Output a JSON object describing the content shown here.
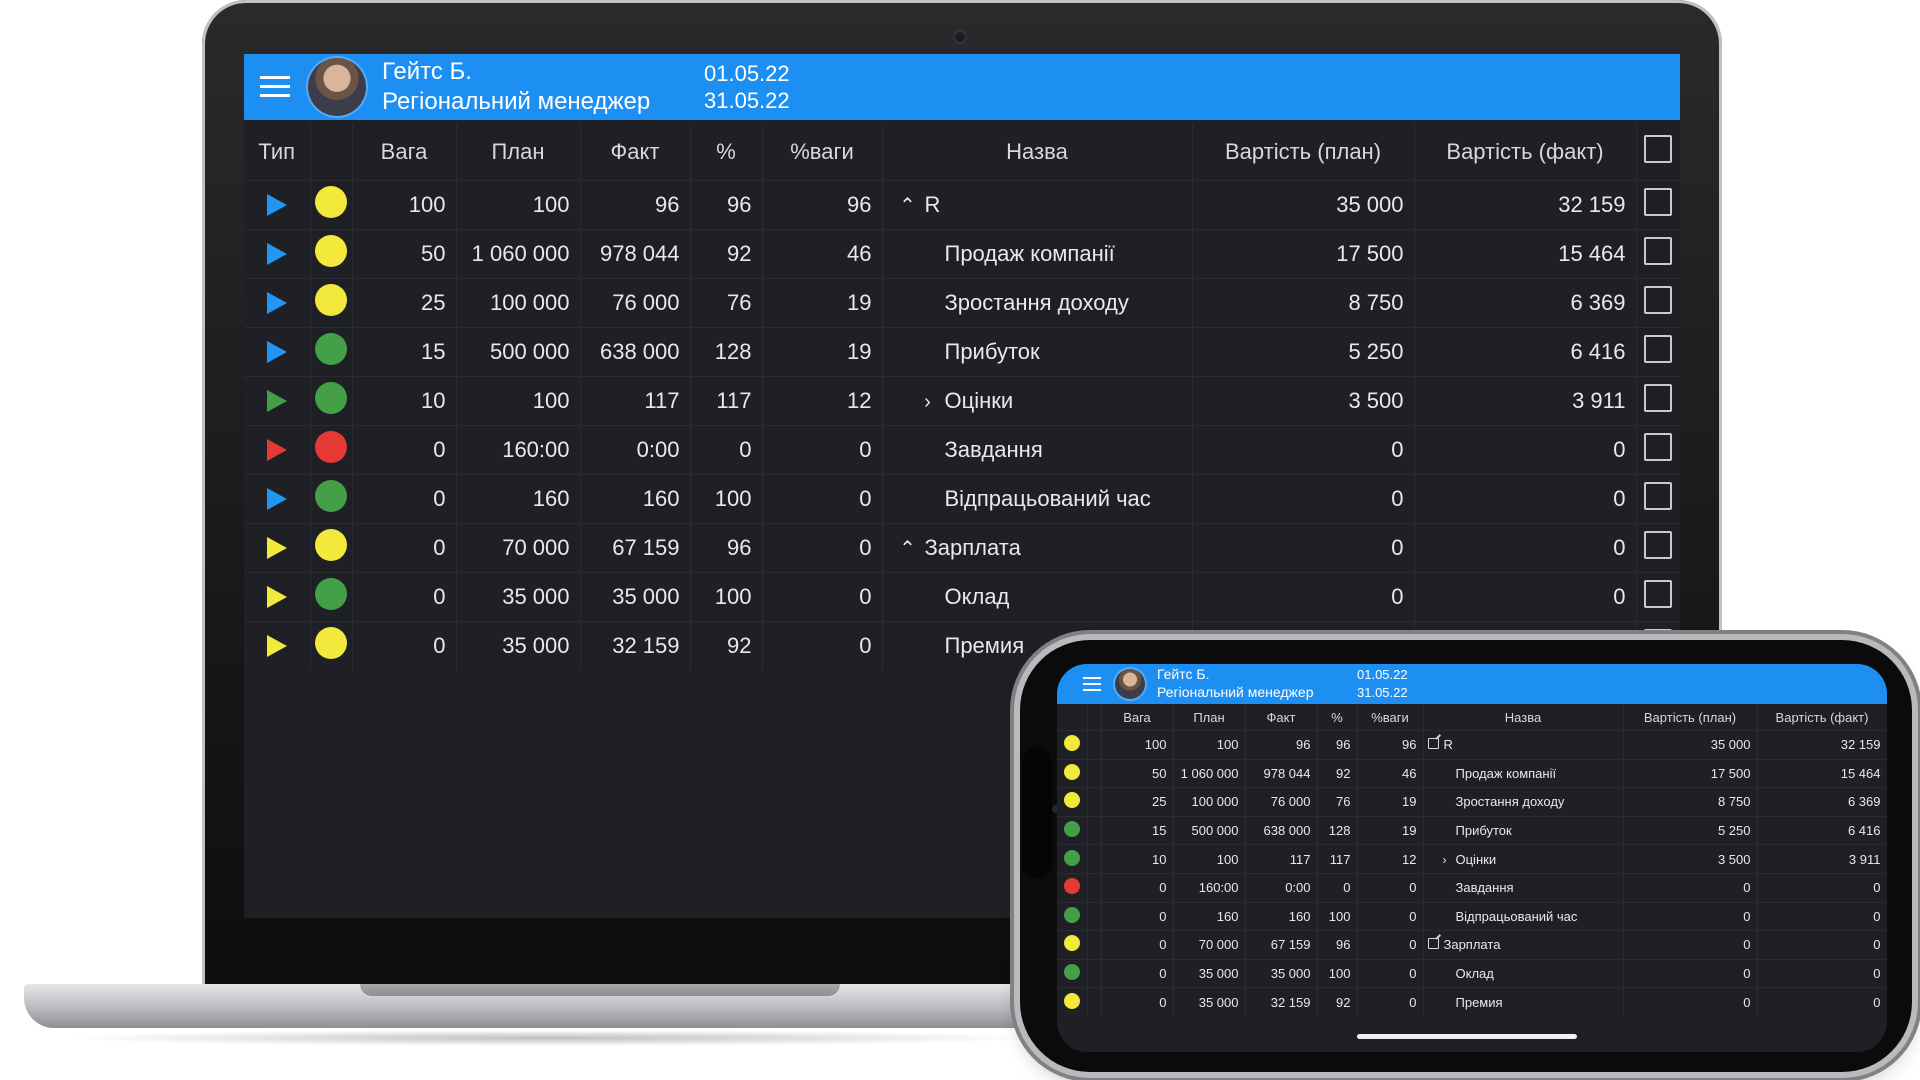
{
  "header": {
    "user_name": "Гейтс Б.",
    "user_role": "Регіональний менеджер",
    "date_from": "01.05.22",
    "date_to": "31.05.22",
    "accent_color": "#1e8ff2"
  },
  "columns": {
    "type": "Тип",
    "weight": "Вага",
    "plan": "План",
    "fact": "Факт",
    "percent": "%",
    "percent_weight": "%ваги",
    "name": "Назва",
    "cost_plan": "Вартість (план)",
    "cost_fact": "Вартість (факт)"
  },
  "rows": [
    {
      "type_color": "blue",
      "status": "yellow",
      "weight": "100",
      "plan": "100",
      "fact": "96",
      "percent": "96",
      "percent_weight": "96",
      "expander": "^",
      "phone_icon": "edit",
      "name": "R",
      "cost_plan": "35 000",
      "cost_fact": "32 159"
    },
    {
      "type_color": "blue",
      "status": "yellow",
      "weight": "50",
      "plan": "1 060 000",
      "fact": "978 044",
      "percent": "92",
      "percent_weight": "46",
      "expander": "",
      "name": "Продаж компанії",
      "cost_plan": "17 500",
      "cost_fact": "15 464"
    },
    {
      "type_color": "blue",
      "status": "yellow",
      "weight": "25",
      "plan": "100 000",
      "fact": "76 000",
      "percent": "76",
      "percent_weight": "19",
      "expander": "",
      "name": "Зростання доходу",
      "cost_plan": "8 750",
      "cost_fact": "6 369"
    },
    {
      "type_color": "blue",
      "status": "green",
      "weight": "15",
      "plan": "500 000",
      "fact": "638 000",
      "percent": "128",
      "percent_weight": "19",
      "expander": "",
      "name": "Прибуток",
      "cost_plan": "5 250",
      "cost_fact": "6 416"
    },
    {
      "type_color": "green",
      "status": "green",
      "weight": "10",
      "plan": "100",
      "fact": "117",
      "percent": "117",
      "percent_weight": "12",
      "expander": ">",
      "name": "Оцінки",
      "cost_plan": "3 500",
      "cost_fact": "3 911"
    },
    {
      "type_color": "red",
      "status": "red",
      "weight": "0",
      "plan": "160:00",
      "fact": "0:00",
      "percent": "0",
      "percent_weight": "0",
      "expander": "",
      "name": "Завдання",
      "cost_plan": "0",
      "cost_fact": "0"
    },
    {
      "type_color": "blue",
      "status": "green",
      "weight": "0",
      "plan": "160",
      "fact": "160",
      "percent": "100",
      "percent_weight": "0",
      "expander": "",
      "name": "Відпрацьований час",
      "cost_plan": "0",
      "cost_fact": "0"
    },
    {
      "type_color": "yellow",
      "status": "yellow",
      "weight": "0",
      "plan": "70 000",
      "fact": "67 159",
      "percent": "96",
      "percent_weight": "0",
      "expander": "^",
      "phone_icon": "edit",
      "name": "Зарплата",
      "cost_plan": "0",
      "cost_fact": "0"
    },
    {
      "type_color": "yellow",
      "status": "green",
      "weight": "0",
      "plan": "35 000",
      "fact": "35 000",
      "percent": "100",
      "percent_weight": "0",
      "expander": "",
      "name": "Оклад",
      "cost_plan": "0",
      "cost_fact": "0"
    },
    {
      "type_color": "yellow",
      "status": "yellow",
      "weight": "0",
      "plan": "35 000",
      "fact": "32 159",
      "percent": "92",
      "percent_weight": "0",
      "expander": "",
      "name": "Премия",
      "cost_plan": "0",
      "cost_fact": "0"
    }
  ]
}
